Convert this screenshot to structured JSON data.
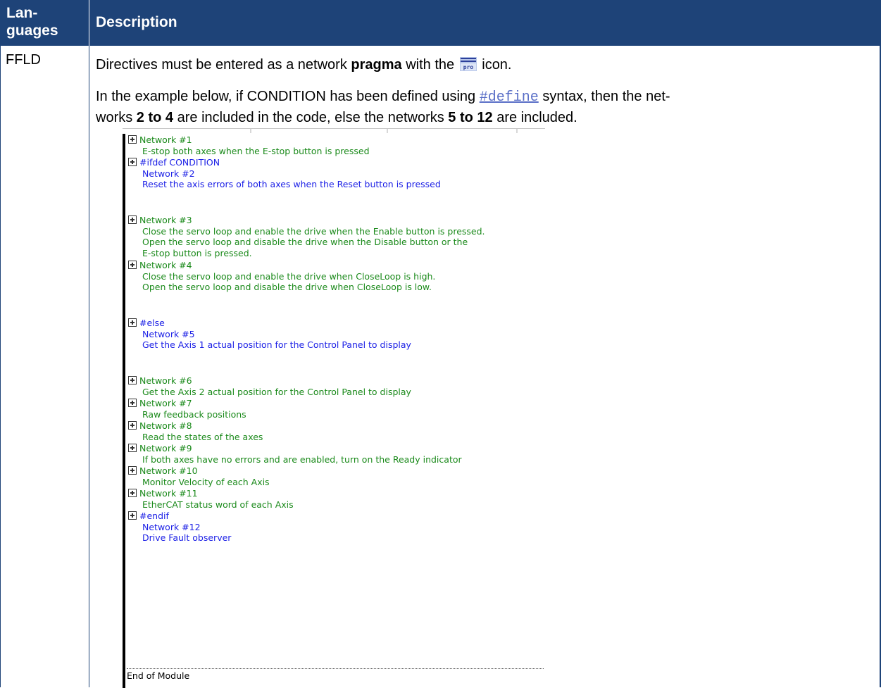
{
  "table": {
    "header": {
      "languages": "Lan-\nguages",
      "languages_l1": "Lan-",
      "languages_l2": "guages",
      "description": "Description"
    },
    "row": {
      "language": "FFLD",
      "p1": {
        "before": "Directives must be entered as a network ",
        "bold": "pragma",
        "middle": " with the ",
        "icon": "pro-pragma-icon",
        "after": " icon."
      },
      "p2": {
        "t1": "In the example below, if CONDITION has been defined using ",
        "link": "#define",
        "t2": " syntax, then the net-",
        "t3": "works ",
        "b1": "2 to 4",
        "t4": " are included in the code, else the networks ",
        "b2": "5 to 12",
        "t5": " are included."
      }
    }
  },
  "screenshot": {
    "networks": [
      {
        "head": "Network #1",
        "lines": [
          "E-stop both axes when the E-stop button is pressed"
        ],
        "color": "green"
      },
      {
        "head": "#ifdef CONDITION",
        "lines": [
          "Network #2",
          "Reset the axis errors of both axes when the Reset button is pressed"
        ],
        "color": "blue"
      },
      {
        "head": "Network #3",
        "lines": [
          "Close the servo loop and enable the drive when the Enable button is pressed.",
          "Open the servo loop and disable the drive when the Disable button or the",
          "E-stop button is pressed."
        ],
        "color": "green"
      },
      {
        "head": "Network #4",
        "lines": [
          "Close the servo loop and enable the drive when CloseLoop is high.",
          "Open the servo loop and disable the drive when CloseLoop is low."
        ],
        "color": "green"
      },
      {
        "head": "#else",
        "lines": [
          "Network #5",
          "Get the Axis 1 actual position for the Control Panel to display"
        ],
        "color": "blue"
      },
      {
        "head": "Network #6",
        "lines": [
          "Get the Axis 2 actual position for the Control Panel to display"
        ],
        "color": "green"
      },
      {
        "head": "Network #7",
        "lines": [
          "Raw feedback positions"
        ],
        "color": "green"
      },
      {
        "head": "Network #8",
        "lines": [
          "Read the states of the axes"
        ],
        "color": "green"
      },
      {
        "head": "Network #9",
        "lines": [
          "If both axes have no errors and are enabled, turn on the Ready indicator"
        ],
        "color": "green"
      },
      {
        "head": "Network #10",
        "lines": [
          "Monitor Velocity of each Axis"
        ],
        "color": "green"
      },
      {
        "head": "Network #11",
        "lines": [
          "EtherCAT status word of each Axis"
        ],
        "color": "green"
      },
      {
        "head": "#endif",
        "lines": [
          "Network #12",
          "Drive Fault observer"
        ],
        "color": "blue"
      }
    ],
    "end_label": "End of Module"
  },
  "colors": {
    "header_bg": "#1e4378",
    "green_text": "#1b8a1b",
    "blue_text": "#1e22e6",
    "link": "#5a6fc7"
  }
}
